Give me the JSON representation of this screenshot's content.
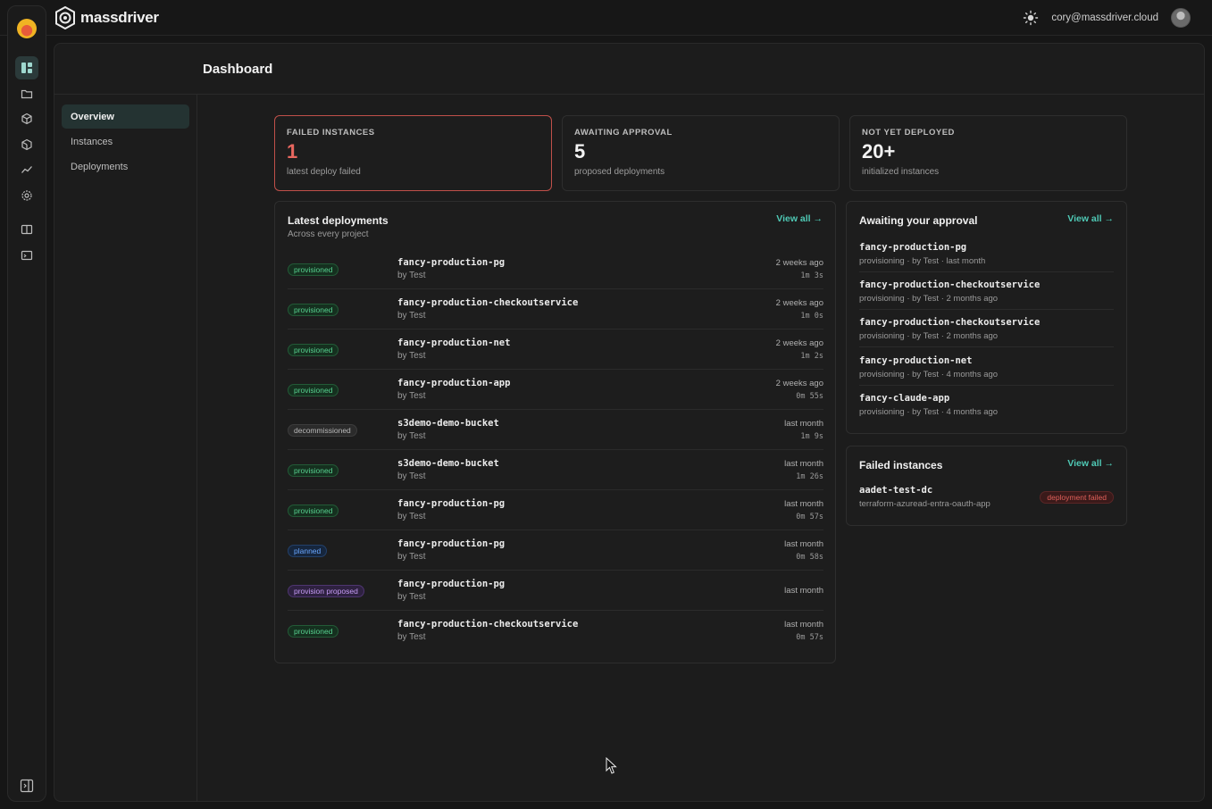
{
  "app": {
    "brand_name": "massdriver",
    "user_email": "cory@massdriver.cloud"
  },
  "header": {
    "title": "Dashboard"
  },
  "rail": {
    "icons": [
      "org-logo",
      "dashboard-icon",
      "folder-icon",
      "bundles-icon",
      "package-icon",
      "metrics-icon",
      "settings-icon",
      "docs-icon",
      "terminal-icon",
      "collapse-sidebar-icon"
    ]
  },
  "subnav": {
    "items": [
      {
        "label": "Overview",
        "active": true
      },
      {
        "label": "Instances"
      },
      {
        "label": "Deployments"
      }
    ]
  },
  "stats": {
    "failed": {
      "label": "FAILED INSTANCES",
      "value": "1",
      "sub": "latest deploy failed"
    },
    "awaiting": {
      "label": "AWAITING APPROVAL",
      "value": "5",
      "sub": "proposed deployments"
    },
    "not_deployed": {
      "label": "NOT YET DEPLOYED",
      "value": "20+",
      "sub": "initialized instances"
    }
  },
  "latest": {
    "title": "Latest deployments",
    "subtitle": "Across every project",
    "view_all": "View all →",
    "rows": [
      {
        "status": "provisioned",
        "name": "fancy-production-pg",
        "by": "by Test",
        "when": "2 weeks ago",
        "duration": "1m 3s"
      },
      {
        "status": "provisioned",
        "name": "fancy-production-checkoutservice",
        "by": "by Test",
        "when": "2 weeks ago",
        "duration": "1m 0s"
      },
      {
        "status": "provisioned",
        "name": "fancy-production-net",
        "by": "by Test",
        "when": "2 weeks ago",
        "duration": "1m 2s"
      },
      {
        "status": "provisioned",
        "name": "fancy-production-app",
        "by": "by Test",
        "when": "2 weeks ago",
        "duration": "0m 55s"
      },
      {
        "status": "decommissioned",
        "name": "s3demo-demo-bucket",
        "by": "by Test",
        "when": "last month",
        "duration": "1m 9s"
      },
      {
        "status": "provisioned",
        "name": "s3demo-demo-bucket",
        "by": "by Test",
        "when": "last month",
        "duration": "1m 26s"
      },
      {
        "status": "provisioned",
        "name": "fancy-production-pg",
        "by": "by Test",
        "when": "last month",
        "duration": "0m 57s"
      },
      {
        "status": "planned",
        "name": "fancy-production-pg",
        "by": "by Test",
        "when": "last month",
        "duration": "0m 58s"
      },
      {
        "status": "provision proposed",
        "name": "fancy-production-pg",
        "by": "by Test",
        "when": "last month",
        "duration": ""
      },
      {
        "status": "provisioned",
        "name": "fancy-production-checkoutservice",
        "by": "by Test",
        "when": "last month",
        "duration": "0m 57s"
      }
    ]
  },
  "approval": {
    "title": "Awaiting your approval",
    "view_all": "View all →",
    "rows": [
      {
        "name": "fancy-production-pg",
        "meta": "provisioning · by Test · last month"
      },
      {
        "name": "fancy-production-checkoutservice",
        "meta": "provisioning · by Test · 2 months ago"
      },
      {
        "name": "fancy-production-checkoutservice",
        "meta": "provisioning · by Test · 2 months ago"
      },
      {
        "name": "fancy-production-net",
        "meta": "provisioning · by Test · 4 months ago"
      },
      {
        "name": "fancy-claude-app",
        "meta": "provisioning · by Test · 4 months ago"
      }
    ]
  },
  "failed_instances": {
    "title": "Failed instances",
    "view_all": "View all →",
    "rows": [
      {
        "name": "aadet-test-dc",
        "meta": "terraform-azuread-entra-oauth-app",
        "badge": "deployment failed"
      }
    ]
  },
  "colors": {
    "accent": "#4fc9b5",
    "danger": "#e8675f",
    "success": "#57d08f",
    "background": "#161616"
  }
}
